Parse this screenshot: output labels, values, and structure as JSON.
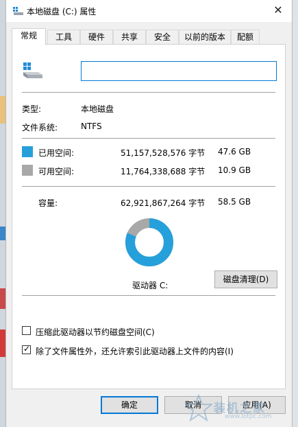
{
  "window": {
    "title": "本地磁盘 (C:) 属性",
    "close_glyph": "✕"
  },
  "tabs": [
    {
      "label": "常规",
      "active": true
    },
    {
      "label": "工具"
    },
    {
      "label": "硬件"
    },
    {
      "label": "共享"
    },
    {
      "label": "安全"
    },
    {
      "label": "以前的版本"
    },
    {
      "label": "配额"
    }
  ],
  "general": {
    "drive_name_value": "",
    "type_label": "类型:",
    "type_value": "本地磁盘",
    "fs_label": "文件系统:",
    "fs_value": "NTFS",
    "used": {
      "label": "已用空间:",
      "bytes": "51,157,528,576 字节",
      "size": "47.6 GB",
      "color": "#26a0da"
    },
    "free": {
      "label": "可用空间:",
      "bytes": "11,764,338,688 字节",
      "size": "10.9 GB",
      "color": "#a8a8a8"
    },
    "capacity": {
      "label": "容量:",
      "bytes": "62,921,867,264 字节",
      "size": "58.5 GB"
    },
    "drive_label": "驱动器 C:",
    "cleanup_button": "磁盘清理(D)",
    "compress_checkbox": {
      "label": "压缩此驱动器以节约磁盘空间(C)",
      "checked": false
    },
    "index_checkbox": {
      "label": "除了文件属性外，还允许索引此驱动器上文件的内容(I)",
      "checked": true
    },
    "used_fraction": 0.813
  },
  "footer": {
    "ok": "确定",
    "cancel": "取消",
    "apply": "应用(A)"
  },
  "watermark": {
    "text": "装机之家",
    "url": "www.lotpc.com"
  }
}
